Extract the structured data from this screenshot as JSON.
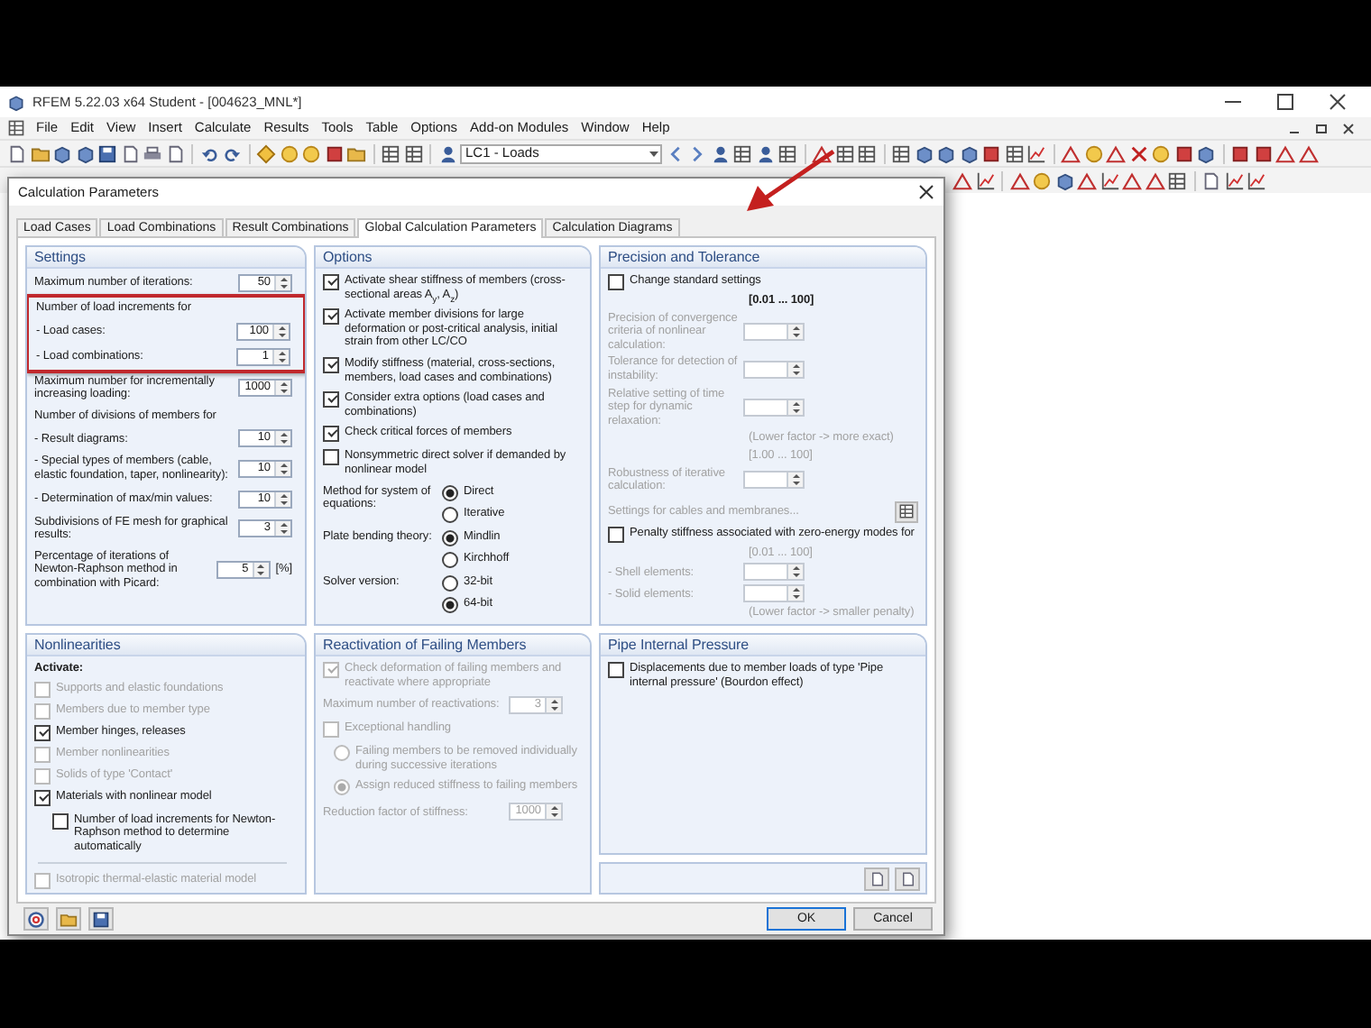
{
  "app": {
    "title": "RFEM 5.22.03 x64 Student - [004623_MNL*]",
    "menu": [
      "File",
      "Edit",
      "View",
      "Insert",
      "Calculate",
      "Results",
      "Tools",
      "Table",
      "Options",
      "Add-on Modules",
      "Window",
      "Help"
    ],
    "load_case": "LC1 - Loads"
  },
  "dialog": {
    "title": "Calculation Parameters",
    "tabs": [
      {
        "label": "Load Cases",
        "selected": false
      },
      {
        "label": "Load Combinations",
        "selected": false
      },
      {
        "label": "Result Combinations",
        "selected": false
      },
      {
        "label": "Global Calculation Parameters",
        "selected": true
      },
      {
        "label": "Calculation Diagrams",
        "selected": false
      }
    ],
    "panels": [
      {
        "title": "Settings",
        "items": [
          {
            "kind": "field",
            "label": "Maximum number of iterations:",
            "value": "50"
          },
          {
            "kind": "group",
            "label": "Number of load increments for",
            "highlighted": true,
            "items": [
              {
                "kind": "field",
                "label": "- Load cases:",
                "value": "100"
              },
              {
                "kind": "field",
                "label": "- Load combinations:",
                "value": "1"
              }
            ]
          },
          {
            "kind": "field",
            "label": "Maximum number for incrementally increasing loading:",
            "value": "1000"
          },
          {
            "kind": "heading",
            "text": "Number of divisions of members for"
          },
          {
            "kind": "field",
            "label": "- Result diagrams:",
            "value": "10"
          },
          {
            "kind": "field",
            "label": "- Special types of members (cable, elastic foundation, taper, nonlinearity):",
            "value": "10"
          },
          {
            "kind": "field",
            "label": "- Determination of max/min values:",
            "value": "10"
          },
          {
            "kind": "field",
            "label": "Subdivisions of FE mesh for graphical results:",
            "value": "3"
          },
          {
            "kind": "field",
            "label": "Percentage of iterations of Newton-Raphson method in combination with Picard:",
            "value": "5",
            "unit": "[%]"
          }
        ]
      },
      {
        "title": "Options",
        "items": [
          {
            "kind": "checkbox",
            "label": "Activate shear stiffness of members (cross-sectional areas A$_{y}$, A$_{z}$)",
            "checked": true
          },
          {
            "kind": "checkbox",
            "label": "Activate member divisions for large deformation or post-critical analysis, initial strain from other LC/CO",
            "checked": true
          },
          {
            "kind": "checkbox",
            "label": "Modify stiffness (material, cross-sections, members, load cases and combinations)",
            "checked": true
          },
          {
            "kind": "checkbox",
            "label": "Consider extra options (load cases and combinations)",
            "checked": true
          },
          {
            "kind": "checkbox",
            "label": "Check critical forces of members",
            "checked": true
          },
          {
            "kind": "checkbox",
            "label": "Nonsymmetric direct solver if demanded by nonlinear model",
            "checked": false
          },
          {
            "kind": "choice",
            "label": "Method for system of equations:",
            "options": [
              {
                "label": "Direct",
                "selected": true
              },
              {
                "label": "Iterative",
                "selected": false
              }
            ]
          },
          {
            "kind": "choice",
            "label": "Plate bending theory:",
            "options": [
              {
                "label": "Mindlin",
                "selected": true
              },
              {
                "label": "Kirchhoff",
                "selected": false
              }
            ]
          },
          {
            "kind": "choice",
            "label": "Solver version:",
            "options": [
              {
                "label": "32-bit",
                "selected": false
              },
              {
                "label": "64-bit",
                "selected": true
              }
            ]
          }
        ]
      },
      {
        "title": "Precision and Tolerance",
        "items": [
          {
            "kind": "checkbox",
            "label": "Change standard settings",
            "checked": false
          },
          {
            "kind": "range",
            "text": "[0.01 ... 100]",
            "disabled": false
          },
          {
            "kind": "field",
            "label": "Precision of convergence criteria of nonlinear calculation:",
            "disabled": true
          },
          {
            "kind": "field",
            "label": "Tolerance for detection of instability:",
            "disabled": true
          },
          {
            "kind": "field",
            "label": "Relative setting of time step for dynamic relaxation:",
            "disabled": true
          },
          {
            "kind": "note",
            "text": "(Lower factor -> more exact)",
            "disabled": true
          },
          {
            "kind": "range",
            "text": "[1.00 ... 100]",
            "disabled": true
          },
          {
            "kind": "field",
            "label": "Robustness of iterative calculation:",
            "disabled": true
          },
          {
            "kind": "link",
            "text": "Settings for cables and membranes...",
            "disabled": true
          },
          {
            "kind": "checkbox",
            "label": "Penalty stiffness associated with zero-energy modes for",
            "checked": false
          },
          {
            "kind": "range",
            "text": "[0.01 ... 100]",
            "disabled": true
          },
          {
            "kind": "field",
            "label": "- Shell elements:",
            "disabled": true
          },
          {
            "kind": "field",
            "label": "- Solid elements:",
            "disabled": true
          },
          {
            "kind": "note",
            "text": "(Lower factor -> smaller penalty)",
            "disabled": true
          }
        ]
      },
      {
        "title": "Nonlinearities",
        "items": [
          {
            "kind": "heading",
            "text": "Activate:",
            "bold": true
          },
          {
            "kind": "checkbox",
            "label": "Supports and elastic foundations",
            "checked": false,
            "disabled": true
          },
          {
            "kind": "checkbox",
            "label": "Members due to member type",
            "checked": false,
            "disabled": true
          },
          {
            "kind": "checkbox",
            "label": "Member hinges, releases",
            "checked": true,
            "disabled": false
          },
          {
            "kind": "checkbox",
            "label": "Member nonlinearities",
            "checked": false,
            "disabled": true
          },
          {
            "kind": "checkbox",
            "label": "Solids of type 'Contact'",
            "checked": false,
            "disabled": true
          },
          {
            "kind": "checkbox",
            "label": "Materials with nonlinear model",
            "checked": true,
            "disabled": false,
            "children": [
              {
                "kind": "checkbox",
                "label": "Number of load increments for Newton-Raphson method to determine automatically",
                "checked": false,
                "disabled": false
              }
            ]
          },
          {
            "kind": "separator"
          },
          {
            "kind": "checkbox",
            "label": "Isotropic thermal-elastic material model",
            "checked": false,
            "disabled": true
          }
        ]
      },
      {
        "title": "Reactivation of Failing Members",
        "items": [
          {
            "kind": "checkbox",
            "label": "Check deformation of failing members and reactivate where appropriate",
            "checked": true,
            "disabled": true
          },
          {
            "kind": "field",
            "label": "Maximum number of reactivations:",
            "value": "3",
            "disabled": true
          },
          {
            "kind": "checkbox",
            "label": "Exceptional handling",
            "checked": false,
            "disabled": true
          },
          {
            "kind": "radio",
            "label": "Failing members to be removed individually during successive iterations",
            "selected": false,
            "disabled": true
          },
          {
            "kind": "radio",
            "label": "Assign reduced stiffness to failing members",
            "selected": true,
            "disabled": true
          },
          {
            "kind": "field",
            "label": "Reduction factor of stiffness:",
            "value": "1000",
            "disabled": true
          }
        ]
      },
      {
        "title": "Pipe Internal Pressure",
        "items": [
          {
            "kind": "checkbox",
            "label": "Displacements due to member loads of type 'Pipe internal pressure' (Bourdon effect)",
            "checked": false,
            "disabled": false
          }
        ]
      }
    ],
    "buttons": [
      {
        "label": "OK",
        "default": true
      },
      {
        "label": "Cancel",
        "default": false
      }
    ]
  }
}
